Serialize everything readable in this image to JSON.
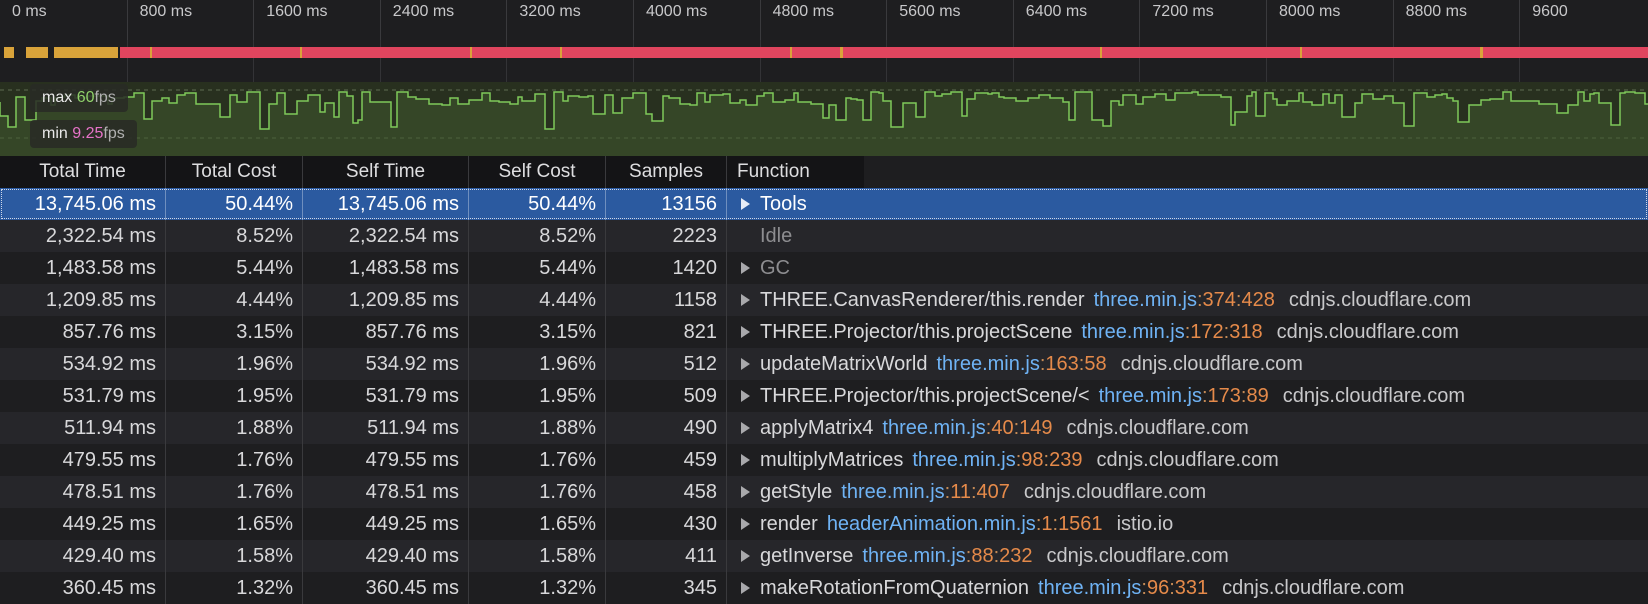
{
  "ruler": {
    "ticks": [
      "0 ms",
      "800 ms",
      "1600 ms",
      "2400 ms",
      "3200 ms",
      "4000 ms",
      "4800 ms",
      "5600 ms",
      "6400 ms",
      "7200 ms",
      "8000 ms",
      "8800 ms",
      "9600"
    ]
  },
  "fps": {
    "max_label": "max",
    "max_value": "60",
    "min_label": "min",
    "min_value": "9.25",
    "unit": "fps"
  },
  "colors": {
    "activity_idle": "#d9a33a",
    "activity_busy": "#e0455e",
    "fps_line": "#7fc95a",
    "selection": "#2b5aa0",
    "file_link": "#6fb3f5",
    "line_number": "#e58a4a"
  },
  "icons": {
    "expand": "disclosure-triangle-icon"
  },
  "table": {
    "headers": [
      "Total Time",
      "Total Cost",
      "Self Time",
      "Self Cost",
      "Samples",
      "Function"
    ],
    "rows": [
      {
        "total_time": "13,745.06 ms",
        "total_cost": "50.44%",
        "self_time": "13,745.06 ms",
        "self_cost": "50.44%",
        "samples": "13156",
        "function": "Tools",
        "file": "",
        "line": "",
        "col": "",
        "domain": "",
        "expandable": true,
        "selected": true,
        "dim": false
      },
      {
        "total_time": "2,322.54 ms",
        "total_cost": "8.52%",
        "self_time": "2,322.54 ms",
        "self_cost": "8.52%",
        "samples": "2223",
        "function": "Idle",
        "file": "",
        "line": "",
        "col": "",
        "domain": "",
        "expandable": false,
        "selected": false,
        "dim": true
      },
      {
        "total_time": "1,483.58 ms",
        "total_cost": "5.44%",
        "self_time": "1,483.58 ms",
        "self_cost": "5.44%",
        "samples": "1420",
        "function": "GC",
        "file": "",
        "line": "",
        "col": "",
        "domain": "",
        "expandable": true,
        "selected": false,
        "dim": true
      },
      {
        "total_time": "1,209.85 ms",
        "total_cost": "4.44%",
        "self_time": "1,209.85 ms",
        "self_cost": "4.44%",
        "samples": "1158",
        "function": "THREE.CanvasRenderer/this.render",
        "file": "three.min.js",
        "line": "374",
        "col": "428",
        "domain": "cdnjs.cloudflare.com",
        "expandable": true,
        "selected": false,
        "dim": false
      },
      {
        "total_time": "857.76 ms",
        "total_cost": "3.15%",
        "self_time": "857.76 ms",
        "self_cost": "3.15%",
        "samples": "821",
        "function": "THREE.Projector/this.projectScene",
        "file": "three.min.js",
        "line": "172",
        "col": "318",
        "domain": "cdnjs.cloudflare.com",
        "expandable": true,
        "selected": false,
        "dim": false
      },
      {
        "total_time": "534.92 ms",
        "total_cost": "1.96%",
        "self_time": "534.92 ms",
        "self_cost": "1.96%",
        "samples": "512",
        "function": "updateMatrixWorld",
        "file": "three.min.js",
        "line": "163",
        "col": "58",
        "domain": "cdnjs.cloudflare.com",
        "expandable": true,
        "selected": false,
        "dim": false
      },
      {
        "total_time": "531.79 ms",
        "total_cost": "1.95%",
        "self_time": "531.79 ms",
        "self_cost": "1.95%",
        "samples": "509",
        "function": "THREE.Projector/this.projectScene/<",
        "file": "three.min.js",
        "line": "173",
        "col": "89",
        "domain": "cdnjs.cloudflare.com",
        "expandable": true,
        "selected": false,
        "dim": false
      },
      {
        "total_time": "511.94 ms",
        "total_cost": "1.88%",
        "self_time": "511.94 ms",
        "self_cost": "1.88%",
        "samples": "490",
        "function": "applyMatrix4",
        "file": "three.min.js",
        "line": "40",
        "col": "149",
        "domain": "cdnjs.cloudflare.com",
        "expandable": true,
        "selected": false,
        "dim": false
      },
      {
        "total_time": "479.55 ms",
        "total_cost": "1.76%",
        "self_time": "479.55 ms",
        "self_cost": "1.76%",
        "samples": "459",
        "function": "multiplyMatrices",
        "file": "three.min.js",
        "line": "98",
        "col": "239",
        "domain": "cdnjs.cloudflare.com",
        "expandable": true,
        "selected": false,
        "dim": false
      },
      {
        "total_time": "478.51 ms",
        "total_cost": "1.76%",
        "self_time": "478.51 ms",
        "self_cost": "1.76%",
        "samples": "458",
        "function": "getStyle",
        "file": "three.min.js",
        "line": "11",
        "col": "407",
        "domain": "cdnjs.cloudflare.com",
        "expandable": true,
        "selected": false,
        "dim": false
      },
      {
        "total_time": "449.25 ms",
        "total_cost": "1.65%",
        "self_time": "449.25 ms",
        "self_cost": "1.65%",
        "samples": "430",
        "function": "render",
        "file": "headerAnimation.min.js",
        "line": "1",
        "col": "1561",
        "domain": "istio.io",
        "expandable": true,
        "selected": false,
        "dim": false
      },
      {
        "total_time": "429.40 ms",
        "total_cost": "1.58%",
        "self_time": "429.40 ms",
        "self_cost": "1.58%",
        "samples": "411",
        "function": "getInverse",
        "file": "three.min.js",
        "line": "88",
        "col": "232",
        "domain": "cdnjs.cloudflare.com",
        "expandable": true,
        "selected": false,
        "dim": false
      },
      {
        "total_time": "360.45 ms",
        "total_cost": "1.32%",
        "self_time": "360.45 ms",
        "self_cost": "1.32%",
        "samples": "345",
        "function": "makeRotationFromQuaternion",
        "file": "three.min.js",
        "line": "96",
        "col": "331",
        "domain": "cdnjs.cloudflare.com",
        "expandable": true,
        "selected": false,
        "dim": false
      }
    ]
  }
}
